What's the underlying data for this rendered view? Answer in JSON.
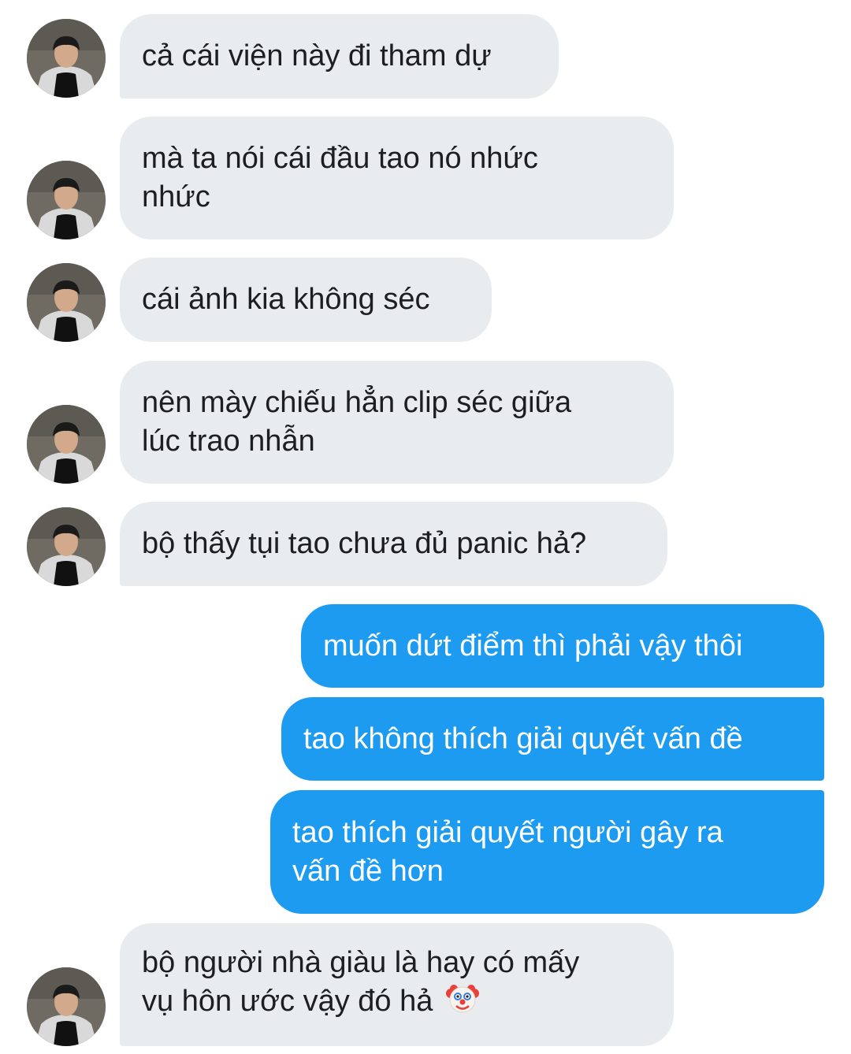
{
  "messages": [
    {
      "direction": "incoming",
      "text": "cả cái viện này đi tham dự"
    },
    {
      "direction": "incoming",
      "text": "mà ta nói cái đầu tao nó nhức\nnhức"
    },
    {
      "direction": "incoming",
      "text": "cái ảnh kia không séc"
    },
    {
      "direction": "incoming",
      "text": "nên mày chiếu hẳn clip séc giữa\nlúc trao nhẫn"
    },
    {
      "direction": "incoming",
      "text": "bộ thấy tụi tao chưa đủ panic hả?"
    },
    {
      "direction": "outgoing",
      "text": "muốn dứt điểm thì phải vậy thôi"
    },
    {
      "direction": "outgoing",
      "text": "tao không thích giải quyết vấn đề"
    },
    {
      "direction": "outgoing",
      "text": "tao thích giải quyết người gây ra\nvấn đề hơn"
    },
    {
      "direction": "incoming",
      "text": "bộ người nhà giàu là hay có mấy\nvụ hôn ước vậy đó hả",
      "emoji": "clown-face"
    }
  ],
  "colors": {
    "incoming_bubble": "#e9ecef",
    "outgoing_bubble": "#1d9bf0",
    "incoming_text": "#1c1e21",
    "outgoing_text": "#ffffff"
  },
  "icons": {
    "avatar": "contact-avatar-photo",
    "emoji": "clown-face-emoji"
  }
}
